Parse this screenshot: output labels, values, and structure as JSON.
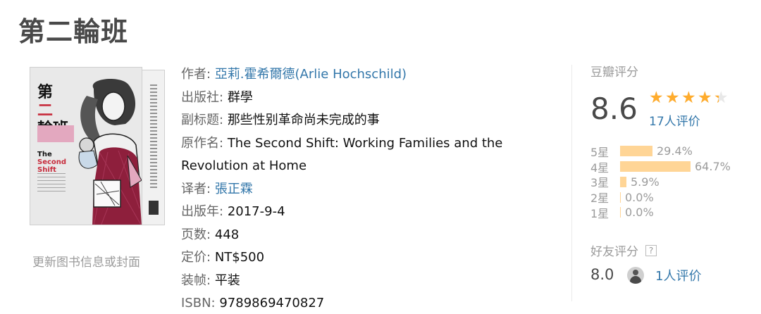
{
  "book": {
    "title": "第二輪班",
    "cover": {
      "title_line1": "第",
      "title_line1_red": "二",
      "title_line2": "輪班",
      "english_title_a": "The",
      "english_title_b": "Second Shift",
      "update_link": "更新图书信息或封面"
    },
    "info": [
      {
        "label": "作者:",
        "value": "亞莉.霍希爾德(Arlie Hochschild)",
        "link": true
      },
      {
        "label": "出版社:",
        "value": "群學",
        "link": false
      },
      {
        "label": "副标题:",
        "value": "那些性别革命尚未完成的事",
        "link": false
      },
      {
        "label": "原作名:",
        "value": "The Second Shift: Working Families and the",
        "link": false
      },
      {
        "label": "",
        "value": "Revolution at Home",
        "link": false
      },
      {
        "label": "译者:",
        "value": "張正霖",
        "link": true
      },
      {
        "label": "出版年:",
        "value": "2017-9-4",
        "link": false
      },
      {
        "label": "页数:",
        "value": "448",
        "link": false
      },
      {
        "label": "定价:",
        "value": "NT$500",
        "link": false
      },
      {
        "label": "装帧:",
        "value": "平装",
        "link": false
      },
      {
        "label": "ISBN:",
        "value": "9789869470827",
        "link": false
      }
    ]
  },
  "rating": {
    "label": "豆瓣评分",
    "score": "8.6",
    "stars_value": 4.3,
    "stars_max": 5,
    "votes": "17人评价",
    "star_color": "#ffac2d",
    "bar_color": "#ffd596",
    "breakdown": [
      {
        "level": "5星",
        "percent": "29.4%",
        "fraction": 0.294
      },
      {
        "level": "4星",
        "percent": "64.7%",
        "fraction": 0.647
      },
      {
        "level": "3星",
        "percent": "5.9%",
        "fraction": 0.059
      },
      {
        "level": "2星",
        "percent": "0.0%",
        "fraction": 0.0
      },
      {
        "level": "1星",
        "percent": "0.0%",
        "fraction": 0.0
      }
    ],
    "friend": {
      "label": "好友评分",
      "help_icon": "?",
      "score": "8.0",
      "votes": "1人评价"
    }
  },
  "colors": {
    "link": "#3377aa",
    "muted": "#9b9b9b"
  },
  "icons": {
    "help": "question-mark-icon",
    "avatar": "user-avatar-icon",
    "star": "star-icon"
  }
}
